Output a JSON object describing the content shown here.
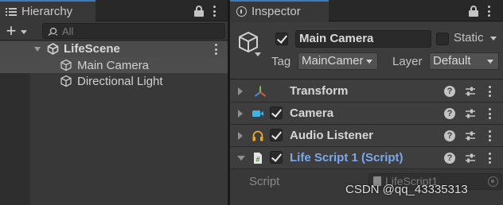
{
  "hierarchy": {
    "tab_label": "Hierarchy",
    "search_placeholder": "All",
    "scene_name": "LifeScene",
    "items": [
      {
        "label": "Main Camera",
        "selected": true
      },
      {
        "label": "Directional Light",
        "selected": false
      }
    ]
  },
  "inspector": {
    "tab_label": "Inspector",
    "object_name": "Main Camera",
    "active": true,
    "static_label": "Static",
    "static": false,
    "tag_label": "Tag",
    "tag_value": "MainCamera",
    "layer_label": "Layer",
    "layer_value": "Default",
    "components": [
      {
        "name": "Transform",
        "icon": "transform-axes-icon",
        "has_toggle": false,
        "expanded": false
      },
      {
        "name": "Camera",
        "icon": "camera-icon",
        "has_toggle": true,
        "enabled": true,
        "expanded": false
      },
      {
        "name": "Audio Listener",
        "icon": "headphones-icon",
        "has_toggle": true,
        "enabled": true,
        "expanded": false
      },
      {
        "name": "Life Script 1 (Script)",
        "icon": "csharp-script-icon",
        "has_toggle": true,
        "enabled": true,
        "expanded": true
      }
    ],
    "script_field_label": "Script",
    "script_field_value": "LifeScript1"
  },
  "watermark": "CSDN @qq_43335313",
  "colors": {
    "panel_bg": "#383838",
    "tab_accent": "#3a79bb",
    "script_name": "#7aa8ec",
    "selection": "#4d4d4d"
  }
}
